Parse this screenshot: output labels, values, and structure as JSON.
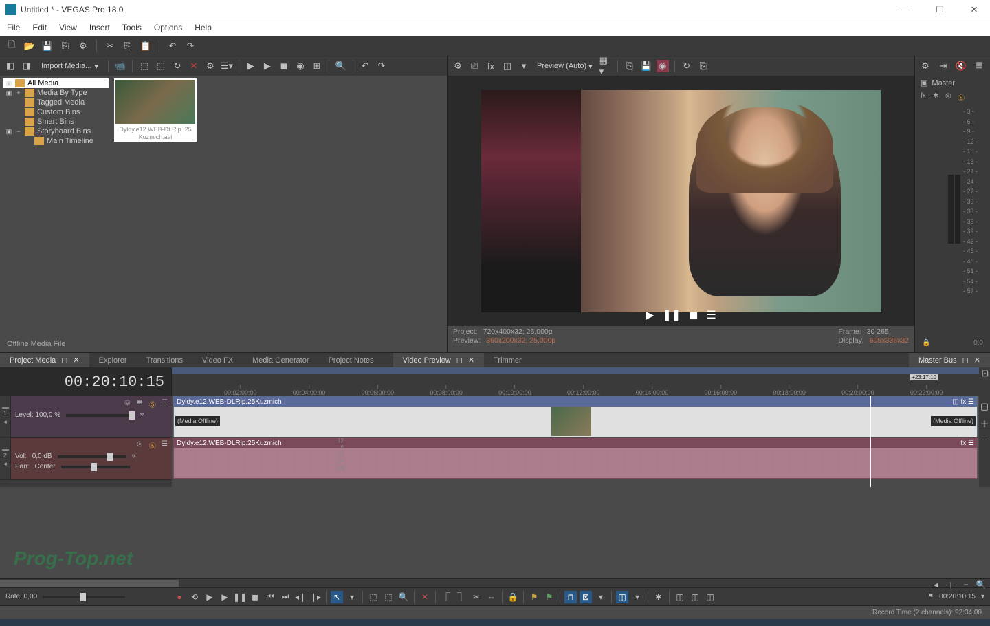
{
  "window": {
    "title": "Untitled * - VEGAS Pro 18.0"
  },
  "menu": [
    "File",
    "Edit",
    "View",
    "Insert",
    "Tools",
    "Options",
    "Help"
  ],
  "mediaPanel": {
    "importLabel": "Import Media...",
    "tree": {
      "allMedia": "All Media",
      "byType": "Media By Type",
      "tagged": "Tagged Media",
      "custom": "Custom Bins",
      "smart": "Smart Bins",
      "storyboard": "Storyboard Bins",
      "mainTimeline": "Main Timeline"
    },
    "clipName": "Dyldy.e12.WEB-DLRip..25 Kuzmich.avi",
    "status": "Offline Media File"
  },
  "preview": {
    "modeLabel": "Preview (Auto)",
    "info": {
      "projectLabel": "Project:",
      "projectVal": "720x400x32; 25,000p",
      "previewLabel": "Preview:",
      "previewVal": "360x200x32; 25,000p",
      "frameLabel": "Frame:",
      "frameVal": "30 265",
      "displayLabel": "Display:",
      "displayVal": "605x336x32"
    }
  },
  "master": {
    "title": "Master",
    "scale": [
      "- 3 -",
      "- 6 -",
      "- 9 -",
      "- 12 -",
      "- 15 -",
      "- 18 -",
      "- 21 -",
      "- 24 -",
      "- 27 -",
      "- 30 -",
      "- 33 -",
      "- 36 -",
      "- 39 -",
      "- 42 -",
      "- 45 -",
      "- 48 -",
      "- 51 -",
      "- 54 -",
      "- 57 -"
    ],
    "lockVal": "0,0"
  },
  "tabsLeft": [
    "Project Media",
    "Explorer",
    "Transitions",
    "Video FX",
    "Media Generator",
    "Project Notes"
  ],
  "tabsRight": [
    "Video Preview",
    "Trimmer"
  ],
  "tabsMaster": "Master Bus",
  "timeline": {
    "timecode": "00:20:10:15",
    "ticks": [
      "00:02:00:00",
      "00:04:00:00",
      "00:06:00:00",
      "00:08:00:00",
      "00:10:00:00",
      "00:12:00:00",
      "00:14:00:00",
      "00:16:00:00",
      "00:18:00:00",
      "00:20:00:00",
      "00:22:00:00"
    ],
    "marker": "+23:17:10",
    "videoTrack": {
      "num": "1",
      "level": "Level: 100,0 %"
    },
    "audioTrack": {
      "num": "2",
      "vol": "Vol:",
      "volVal": "0,0 dB",
      "pan": "Pan:",
      "panVal": "Center",
      "db": [
        "12",
        "6",
        "12",
        "24",
        "48"
      ]
    },
    "clipName": "Dyldy.e12.WEB-DLRip.25Kuzmich",
    "mediaOffline": "(Media Offline)",
    "rate": "Rate: 0,00",
    "bottomTime": "00:20:10:15"
  },
  "status": "Record Time (2 channels): 92:34:00",
  "watermark": "Prog-Top.net"
}
